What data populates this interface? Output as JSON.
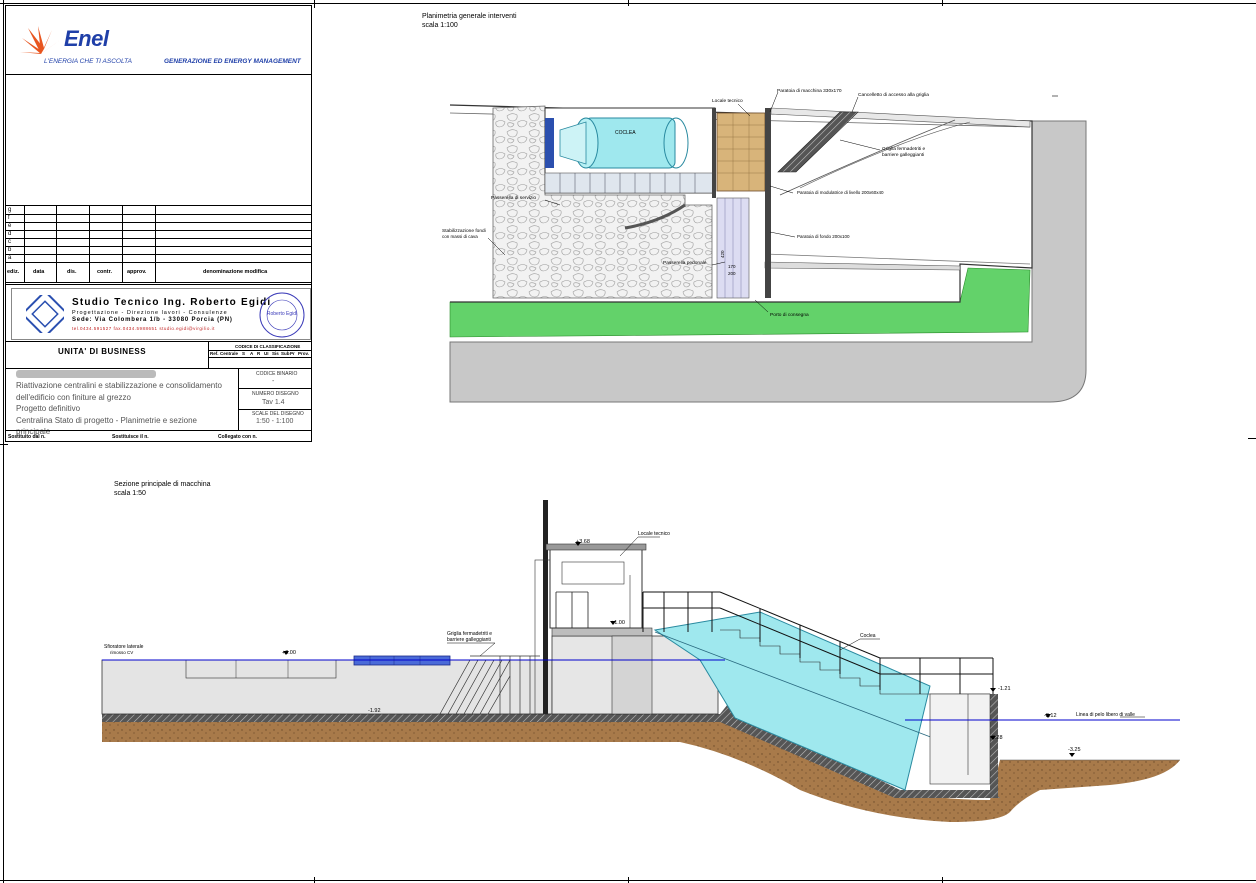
{
  "title_block": {
    "logo_word": "Enel",
    "logo_tagline": "L'ENERGIA CHE TI ASCOLTA",
    "division": "GENERAZIONE ED ENERGY MANAGEMENT",
    "revision_letters": [
      "g",
      "f",
      "e",
      "d",
      "c",
      "b",
      "a"
    ],
    "revision_headers": {
      "ediz": "ediz.",
      "data": "data",
      "dis": "dis.",
      "contr": "contr.",
      "approv": "approv.",
      "denominazione": "denominazione modifica"
    },
    "studio": {
      "name": "Studio Tecnico Ing. Roberto Egidi",
      "subtitle": "Progettazione - Direzione lavori - Consulenze",
      "address": "Sede: Via Colombera 1/b - 33080 Porcia (PN)",
      "contacts": "tel.0434.591527 fax.0434.5988651 studio.egidi@virgilio.it",
      "stamp_name": "Roberto Egidi"
    },
    "business_unit": "UNITA' DI BUSINESS",
    "classification_header": "CODICE DI CLASSIFICAZIONE",
    "classification_cols": [
      "Ref.",
      "Centrale",
      "S",
      "A",
      "R",
      "UI",
      "Sis",
      "Sub",
      "Pr",
      "Prov."
    ],
    "project_lines": [
      "Riattivazione centralini e stabilizzazione e consolidamento",
      "dell'edificio con finiture al grezzo",
      "Progetto definitivo",
      "Centralina Stato di progetto - Planimetrie e sezione principale"
    ],
    "codice_label": "CODICE BINARIO",
    "codice_value": "-",
    "numero_label": "NUMERO DISEGNO",
    "numero_value": "Tav 1.4",
    "scala_label": "SCALE DEL DISEGNO",
    "scala_value": "1:50 - 1:100",
    "sostituito_da": "Sostituito dal n.",
    "sostituisce": "Sostituisce il n.",
    "collegato": "Collegato con n."
  },
  "plan": {
    "title": "Planimetria generale interventi",
    "scale": "scala 1:100",
    "labels": {
      "locale": "Locale tecnico",
      "paratoia_macchina": "Paratoia di macchina 330x170",
      "cancelletto": "Cancelletto di accesso alla griglia",
      "coclea": "COCLEA",
      "griglia": "Griglia fermadetriti e",
      "barriere": "barriere galleggianti",
      "paratoia_modulatrice": "Paratoia di modulatrice di livello 200x60x40",
      "passerella_servizio": "Passerella di servizio",
      "stabilizzazione": "Stabilizzazione fondi",
      "stabilizzazione2": "con massi di cava",
      "paratoia_fondo": "Paratoia di fondo 200x100",
      "passerella_pedonale": "Passerella pedonale",
      "dim_420": "420",
      "dim_170": "170",
      "dim_200": "200",
      "porto": "Porto di consegna"
    }
  },
  "section": {
    "title": "Sezione principale di macchina",
    "scale": "scala 1:50",
    "labels": {
      "locale": "Locale tecnico",
      "griglia": "Griglia fermadetriti e",
      "barriere": "barriere galleggianti",
      "sfioratore": "Sfioratore laterale",
      "sfioratore2": "rimosso CV",
      "coclea": "Coclea",
      "linea_valle": "Linea di pelo libero di valle"
    },
    "elevations": {
      "e_top": "+3.68",
      "e_floor": "+1.00",
      "e_water": "+0.00",
      "e_bottom": "-1.92",
      "e_out": "-1.21",
      "e_valle": "-2.12",
      "e_sill": "-2.28",
      "e_base": "-3.25"
    }
  },
  "colors": {
    "enel_blue": "#1f3fa8",
    "water_cyan": "#9fe8ee",
    "grass_green": "#63d26a",
    "road_gray": "#c8c8c8",
    "wood": "#d8b47a",
    "soil": "#a87a4a",
    "water_line": "#0000cc"
  }
}
